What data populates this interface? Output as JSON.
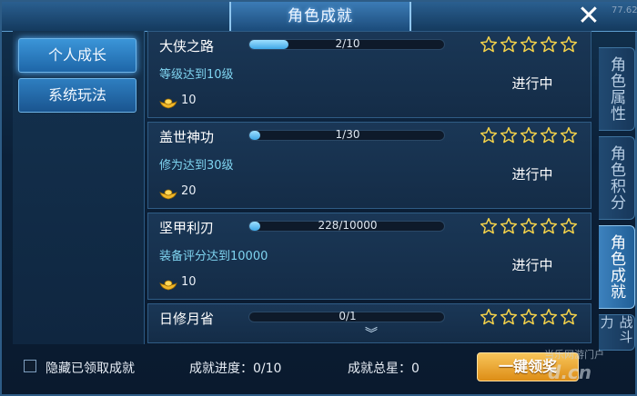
{
  "window": {
    "title": "角色成就",
    "top_right_number": "77.62"
  },
  "left_nav": [
    {
      "label": "个人成长",
      "active": true
    },
    {
      "label": "系统玩法",
      "active": false
    }
  ],
  "achievements": [
    {
      "name": "大侠之路",
      "progress_text": "2/10",
      "progress": 0.2,
      "desc": "等级达到10级",
      "reward": "10",
      "stars_filled": 0,
      "status": "进行中"
    },
    {
      "name": "盖世神功",
      "progress_text": "1/30",
      "progress": 0.033,
      "desc": "修为达到30级",
      "reward": "20",
      "stars_filled": 0,
      "status": "进行中"
    },
    {
      "name": "坚甲利刃",
      "progress_text": "228/10000",
      "progress": 0.0228,
      "desc": "装备评分达到10000",
      "reward": "10",
      "stars_filled": 0,
      "status": "进行中"
    },
    {
      "name": "日修月省",
      "progress_text": "0/1",
      "progress": 0,
      "desc": "",
      "reward": "",
      "stars_filled": 0,
      "status": ""
    }
  ],
  "right_tabs": [
    {
      "label": "角色属性",
      "active": false
    },
    {
      "label": "角色积分",
      "active": false
    },
    {
      "label": "角色成就",
      "active": true
    },
    {
      "label": "战斗力",
      "active": false
    }
  ],
  "bottom": {
    "hide_claimed_label": "隐藏已领取成就",
    "progress_label": "成就进度：0/10",
    "total_stars_label": "成就总星：0",
    "claim_all_label": "一键领奖"
  },
  "watermark": {
    "line1": "当乐网游门户",
    "line2": "d.cn"
  },
  "colors": {
    "accent": "#3fa7e6",
    "desc_text": "#7fd4f0",
    "claim_button": "#f2ad3a",
    "star_outline": "#f4d24a"
  },
  "icons": {
    "close": "close-icon",
    "reward": "gold-ingot-icon",
    "star": "star-outline-icon",
    "more": "chevron-down-icon"
  }
}
